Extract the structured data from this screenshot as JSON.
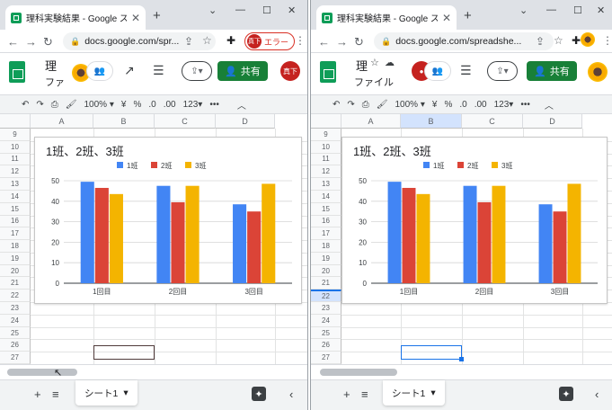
{
  "left": {
    "tab_title": "理科実験結果 - Google スプレッドシ",
    "url": "docs.google.com/spr...",
    "error_label": "エラー",
    "avatar_label": "真下",
    "sheet_title_glyph": "理",
    "menu_file": "ファ",
    "share_label": "共有",
    "big_avatar_label": "真下"
  },
  "right": {
    "tab_title": "理科実験結果 - Google スプレッドシ",
    "url": "docs.google.com/spreadshe...",
    "sheet_title_glyph": "理",
    "menu_file": "ファイル",
    "share_label": "共有"
  },
  "toolbar": {
    "zoom": "100%",
    "currency": "¥",
    "percent": "%",
    "dec_decrease": ".0",
    "dec_increase": ".00",
    "number_format": "123",
    "more": "•••"
  },
  "grid": {
    "columns": [
      "A",
      "B",
      "C",
      "D"
    ],
    "rows": [
      "9",
      "10",
      "11",
      "12",
      "13",
      "14",
      "15",
      "16",
      "17",
      "18",
      "19",
      "20",
      "21",
      "22",
      "23",
      "24",
      "25",
      "26",
      "27"
    ]
  },
  "sheet_tab": "シート1",
  "icons": {
    "favicon": "sheets-icon",
    "close": "close-icon",
    "new_tab": "plus-icon",
    "back": "back-arrow-icon",
    "forward": "forward-arrow-icon",
    "reload": "reload-icon",
    "lock": "lock-icon",
    "share_page": "share-page-icon",
    "star": "star-icon",
    "extensions": "puzzle-icon",
    "menu": "kebab-menu-icon"
  },
  "colors": {
    "series1": "#4285f4",
    "series2": "#db4437",
    "series3": "#f4b400",
    "share": "#188038"
  },
  "chart_data": {
    "type": "bar",
    "title": "1班、2班、3班",
    "categories": [
      "1回目",
      "2回目",
      "3回目"
    ],
    "series": [
      {
        "name": "1班",
        "values": [
          49.5,
          47.5,
          38.5
        ]
      },
      {
        "name": "2班",
        "values": [
          46.5,
          39.5,
          35
        ]
      },
      {
        "name": "3班",
        "values": [
          43.5,
          47.5,
          48.5
        ]
      }
    ],
    "ylim": [
      0,
      50
    ],
    "yticks": [
      0,
      10,
      20,
      30,
      40,
      50
    ],
    "grid": true,
    "legend": "top",
    "xlabel": "",
    "ylabel": ""
  }
}
